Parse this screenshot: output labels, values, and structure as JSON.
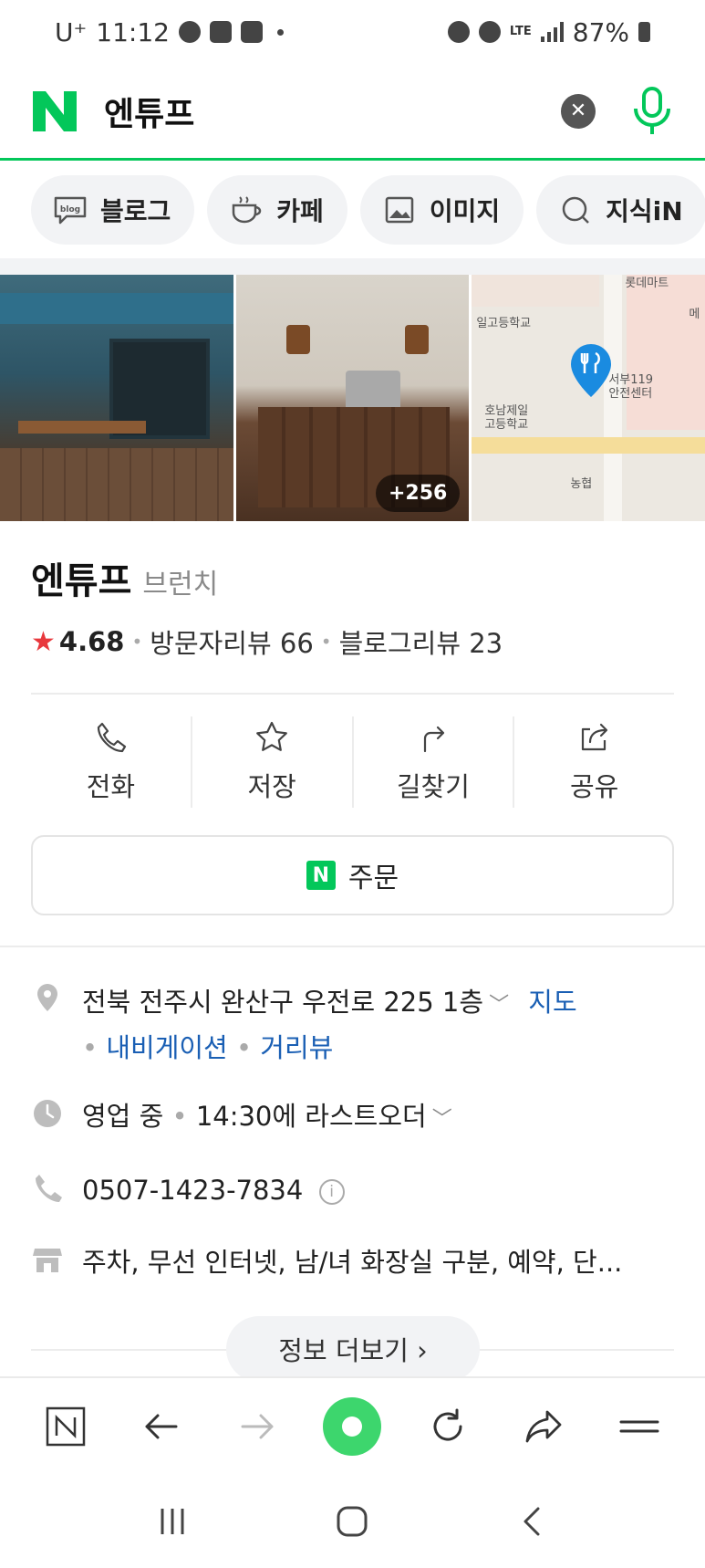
{
  "status_bar": {
    "carrier": "U⁺",
    "time": "11:12",
    "network": "LTE",
    "battery": "87%"
  },
  "search": {
    "query": "엔튜프",
    "clear_icon": "close-icon",
    "mic_icon": "mic-icon"
  },
  "chips": [
    {
      "label": "블로그",
      "icon": "blog-icon"
    },
    {
      "label": "카페",
      "icon": "cafe-icon"
    },
    {
      "label": "이미지",
      "icon": "image-icon"
    },
    {
      "label": "지식iN",
      "icon": "knowledge-icon"
    }
  ],
  "photos": {
    "more_count": "+256",
    "map_labels": {
      "top": "롯데마트",
      "school1": "일고등학교",
      "fire": "서부119\n안전센터",
      "school2": "호남제일\n고등학교",
      "bank": "농협",
      "edge": "메"
    }
  },
  "place": {
    "name": "엔튜프",
    "category": "브런치",
    "rating": "4.68",
    "visitor_reviews": "방문자리뷰 66",
    "blog_reviews": "블로그리뷰 23"
  },
  "actions": [
    {
      "label": "전화",
      "icon": "phone-icon"
    },
    {
      "label": "저장",
      "icon": "star-icon"
    },
    {
      "label": "길찾기",
      "icon": "directions-icon"
    },
    {
      "label": "공유",
      "icon": "share-icon"
    }
  ],
  "order_button": {
    "label": "주문",
    "badge": "N"
  },
  "info": {
    "address": "전북 전주시 완산구 우전로 225 1층",
    "map_link": "지도",
    "navigation_link": "내비게이션",
    "streetview_link": "거리뷰",
    "hours_status": "영업 중",
    "hours_detail": "14:30에 라스트오더",
    "phone": "0507-1423-7834",
    "amenities": "주차, 무선 인터넷, 남/녀 화장실 구분, 예약, 단..."
  },
  "more_info": "정보 더보기 ›",
  "colors": {
    "naver_green": "#03c75a",
    "link_blue": "#1a5fb4",
    "star_red": "#e8383d"
  }
}
